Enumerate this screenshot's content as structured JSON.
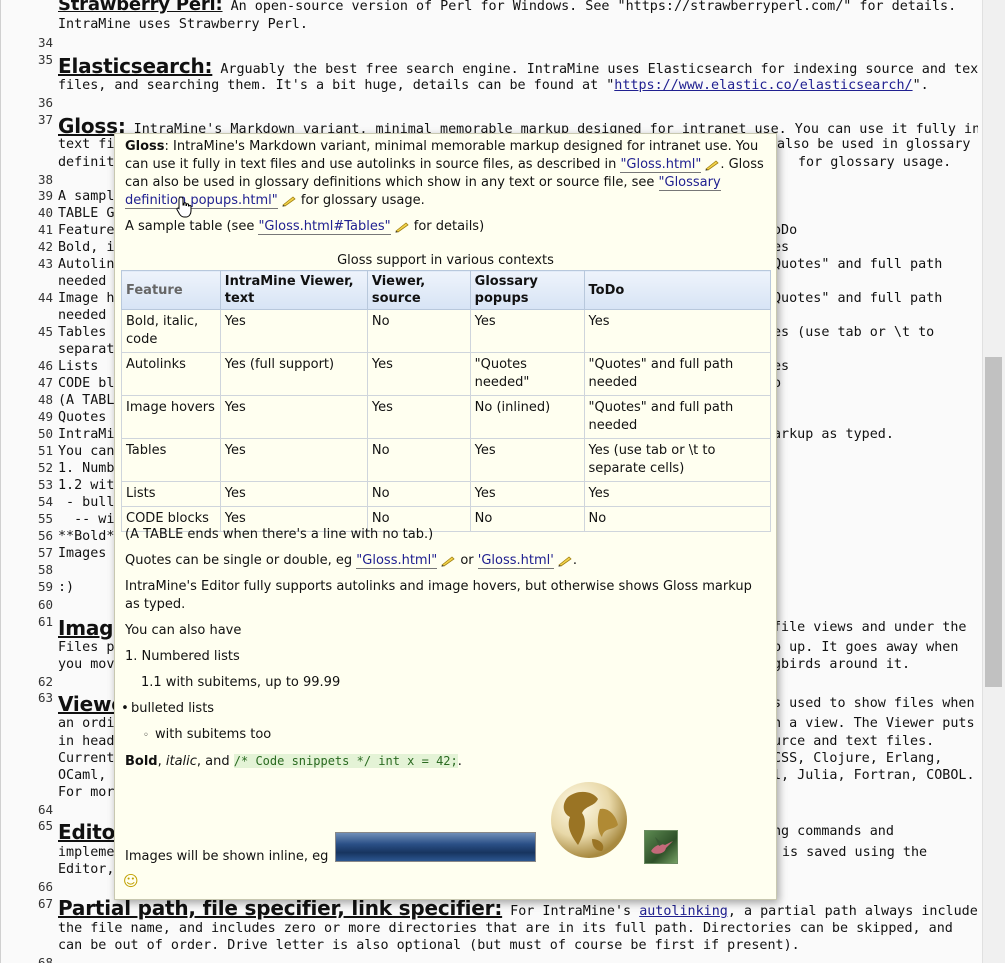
{
  "viewer": {
    "lines": [
      {
        "n": "",
        "html_key": "l33"
      },
      {
        "n": "34"
      },
      {
        "n": "35"
      },
      {
        "n": "36"
      },
      {
        "n": "37"
      },
      {
        "n": "38"
      },
      {
        "n": "39"
      },
      {
        "n": "40"
      },
      {
        "n": "41"
      },
      {
        "n": "42"
      },
      {
        "n": "43"
      },
      {
        "n": "44"
      },
      {
        "n": "45"
      },
      {
        "n": "46"
      },
      {
        "n": "47"
      },
      {
        "n": "48"
      },
      {
        "n": "49"
      },
      {
        "n": "50"
      },
      {
        "n": "51"
      },
      {
        "n": "52"
      },
      {
        "n": "53"
      },
      {
        "n": "54"
      },
      {
        "n": "55"
      },
      {
        "n": "56"
      },
      {
        "n": "57"
      },
      {
        "n": "58"
      },
      {
        "n": "59"
      },
      {
        "n": "60"
      },
      {
        "n": "61"
      },
      {
        "n": "62"
      },
      {
        "n": "63"
      },
      {
        "n": "64"
      },
      {
        "n": "65"
      },
      {
        "n": "66"
      },
      {
        "n": "67"
      },
      {
        "n": "68"
      }
    ],
    "t_perl_tail": "An open-source version of Perl for Windows. See \"https://strawberryperl.com/\" for details.",
    "t_perl_2": "IntraMine uses Strawberry Perl.",
    "h_elastic": "Elasticsearch:",
    "t_elastic_1": " Arguably the best free search engine. IntraMine uses Elasticsearch for indexing source and text",
    "t_elastic_2a": "files, and searching them. It's a bit huge, details can be found at \"",
    "t_elastic_link": "https://www.elastic.co/elasticsearch/",
    "t_elastic_2b": "\".",
    "h_gloss": "Gloss:",
    "t_gloss_1": " IntraMine's Markdown variant, minimal memorable markup designed for intranet use. You can use it fully in",
    "t_gloss_2": "text fi",
    "t_gloss_2r": "also be used in glossary",
    "t_gloss_3": "definit",
    "t_gloss_3r": "for glossary usage.",
    "t39": "A sampl",
    "t40": "TABLE G",
    "t41": "Feature",
    "t41r": "oDo",
    "t42": "Bold, i",
    "t42r": "es",
    "t43": "Autolin",
    "t43r": "Quotes\" and full path",
    "t43b": "needed",
    "t44": "Image h",
    "t44r": "Quotes\" and full path",
    "t44b": "needed",
    "t45": "Tables",
    "t45r": "es (use tab or \\t to",
    "t45b": "separat",
    "t46": "Lists",
    "t46r": "es",
    "t47": "CODE bl",
    "t47r": "o",
    "t48": "(A TABL",
    "t49": "Quotes",
    "t50": "IntraMi",
    "t50r": "arkup as typed.",
    "t51": "You can",
    "t52": "1. Numb",
    "t53": "1.2 wit",
    "t54": " - bull",
    "t55": "  -- wi",
    "t56": "**Bold*",
    "t57": "Images",
    "t59": ":)",
    "h_images": "Image",
    "t61r": "file views and under the",
    "t61b": "Files p",
    "t61br": "p up. It goes away when",
    "t61c": "you mov",
    "t61cr": "gbirds around it.",
    "h_viewer": "Viewe",
    "t63r": "s used to show files when",
    "t63b": "an ordi",
    "t63br": "n a view. The Viewer puts",
    "t63c": "in head",
    "t63cr": "urce and text files.",
    "t63d": "Current",
    "t63dr": "CSS, Clojure, Erlang,",
    "t63e": "OCaml,",
    "t63er": "l, Julia, Fortran, COBOL.",
    "t63f": "For mor",
    "h_editor": "Editor",
    "t65r": "ng commands and",
    "t65b": "impleme",
    "t65br": "is saved using the",
    "t65c": "Editor,",
    "h_partial": "Partial path, file specifier, link specifier:",
    "t67_1a": " For IntraMine's ",
    "t67_1link": "autolinking",
    "t67_1b": ", a partial path always includes",
    "t67_2": "the file name, and includes zero or more directories that are in its full path. Directories can be skipped, and",
    "t67_3": "can be out of order. Drive letter is also optional (but must of course be first if present)."
  },
  "popup": {
    "p1_bold": "Gloss",
    "p1_text": ": IntraMine's Markdown variant, minimal memorable markup designed for intranet use. You can use it fully in text files and use autolinks in source files, as described in ",
    "p1_link": "\"Gloss.html\"",
    "p1_text2": ". Gloss can also be used in glossary definitions which show in any text or source file, see ",
    "p1_link2": "\"Glossary definition popups.html\"",
    "p1_text3": " for glossary usage.",
    "p2_text": "A sample table (see ",
    "p2_link": "\"Gloss.html#Tables\"",
    "p2_text2": " for details)",
    "table_caption": "Gloss support in various contexts",
    "headers": [
      "Feature",
      "IntraMine Viewer, text",
      "Viewer, source",
      "Glossary popups",
      "ToDo"
    ],
    "rows": [
      [
        "Bold, italic, code",
        "Yes",
        "No",
        "Yes",
        "Yes"
      ],
      [
        "Autolinks",
        "Yes (full support)",
        "Yes",
        "\"Quotes needed\"",
        "\"Quotes\" and full path needed"
      ],
      [
        "Image hovers",
        "Yes",
        "Yes",
        "No (inlined)",
        "\"Quotes\" and full path needed"
      ],
      [
        "Tables",
        "Yes",
        "No",
        "Yes",
        "Yes (use tab or \\t to separate cells)"
      ],
      [
        "Lists",
        "Yes",
        "No",
        "Yes",
        "Yes"
      ],
      [
        "CODE blocks",
        "Yes",
        "No",
        "No",
        "No"
      ]
    ],
    "p3": "(A TABLE ends when there's a line with no tab.)",
    "p4_text": "Quotes can be single or double, eg ",
    "p4_link1": "\"Gloss.html\"",
    "p4_or": " or ",
    "p4_link2": "'Gloss.html'",
    "p4_end": ".",
    "p5": "IntraMine's Editor fully supports autolinks and image hovers, but otherwise shows Gloss markup as typed.",
    "p6": "You can also have",
    "p7": "1. Numbered lists",
    "p8": "1.1 with subitems, up to 99.99",
    "p9": "bulleted lists",
    "p10": "with subitems too",
    "p11_bold": "Bold",
    "p11_sep1": ", ",
    "p11_italic": "italic",
    "p11_sep2": ", and ",
    "p11_code": "/* Code snippets */ int x = 42;",
    "p11_end": ".",
    "p12": "Images will be shown inline, eg",
    "emoji": "☺"
  },
  "colors": {
    "popup_bg": "#fffff0",
    "link": "#202090",
    "table_header": "#d7e4f5",
    "code_bg": "#e4f3d6"
  }
}
